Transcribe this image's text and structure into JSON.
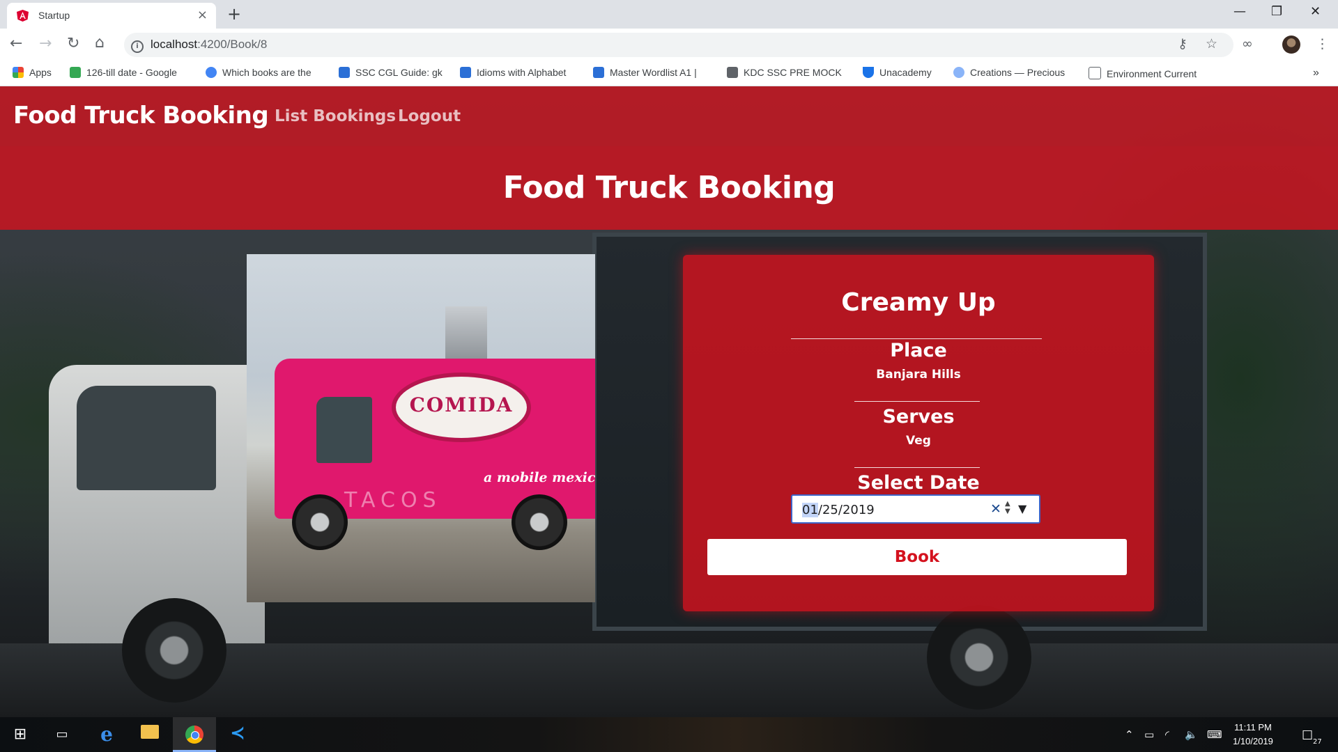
{
  "browser": {
    "tab_title": "Startup",
    "tab_close": "×",
    "new_tab": "+",
    "url_host": "localhost",
    "url_path": ":4200/Book/8",
    "window_controls": {
      "minimize": "—",
      "restore": "❐",
      "close": "✕"
    }
  },
  "bookmarks": [
    {
      "label": "Apps",
      "color": "#ea4335"
    },
    {
      "label": "126-till date - Google",
      "color": "#34a853"
    },
    {
      "label": "Which books are the",
      "color": "#4285f4"
    },
    {
      "label": "SSC CGL Guide: gk",
      "color": "#2b6fd6"
    },
    {
      "label": "Idioms with Alphabet",
      "color": "#2b6fd6"
    },
    {
      "label": "Master Wordlist A1 |",
      "color": "#2b6fd6"
    },
    {
      "label": "KDC SSC PRE MOCK",
      "color": "#5f6368"
    },
    {
      "label": "Unacademy",
      "color": "#1a73e8"
    },
    {
      "label": "Creations — Precious",
      "color": "#8ab4f8"
    },
    {
      "label": "Environment Current",
      "color": "#ffffff"
    }
  ],
  "bookmarks_more": "»",
  "navbar": {
    "brand": "Food Truck Booking",
    "links": [
      "List Bookings",
      "Logout"
    ]
  },
  "hero": {
    "title": "Food Truck Booking"
  },
  "photo": {
    "sign": "COMIDA",
    "tagline": "a mobile mexic",
    "side_text": "TACOS"
  },
  "truck": {
    "name": "Creamy Up",
    "place_label": "Place",
    "place_value": "Banjara Hills",
    "serves_label": "Serves",
    "serves_value": "Veg",
    "date_label": "Select Date",
    "date_value_selected": "01",
    "date_value_rest": "/25/2019",
    "book_label": "Book"
  },
  "taskbar": {
    "time": "11:11 PM",
    "date": "1/10/2019",
    "notifications": "27"
  },
  "colors": {
    "accent_red": "#d4121e",
    "focus_blue": "#3d64c8"
  }
}
